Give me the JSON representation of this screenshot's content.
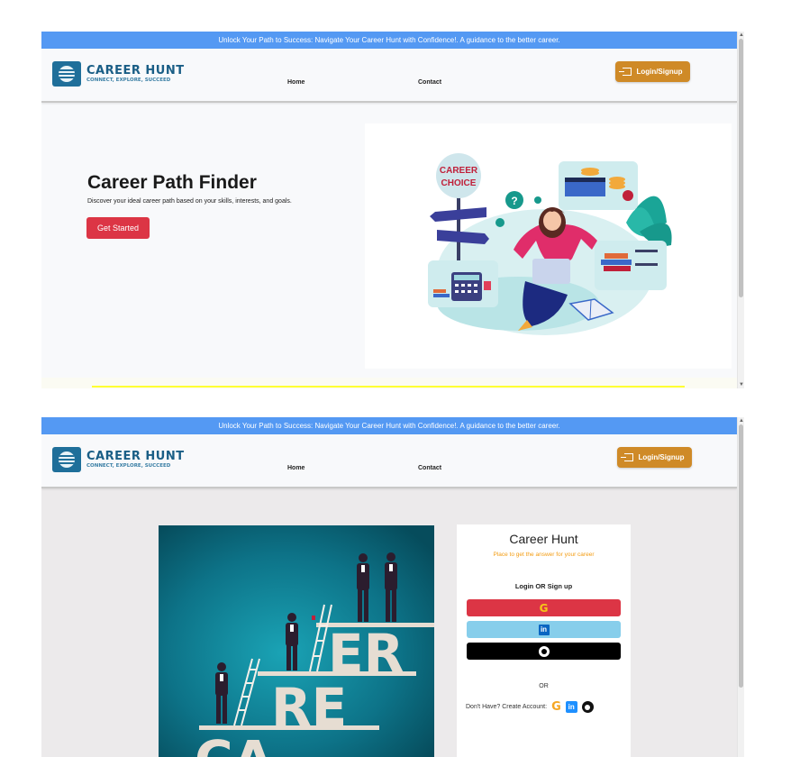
{
  "banner": {
    "text": "Unlock Your Path to Success: Navigate Your Career Hunt with Confidence!. A guidance to the better career."
  },
  "brand": {
    "name": "CAREER HUNT",
    "tagline": "CONNECT, EXPLORE, SUCCEED"
  },
  "nav": {
    "home": "Home",
    "contact": "Contact",
    "login_signup": "Login/Signup"
  },
  "hero": {
    "title": "Career Path Finder",
    "subtitle": "Discover your ideal career path based on your skills, interests, and goals.",
    "cta": "Get Started",
    "sign_text": "CAREER CHOICE"
  },
  "login": {
    "title": "Career Hunt",
    "subtitle": "Place to get the answer for your career",
    "heading": "Login OR Sign up",
    "or": "OR",
    "create_account": "Don't Have? Create Account:"
  },
  "poster": {
    "letters_top": "ER",
    "letters_mid": "RE",
    "letters_bottom": "CA"
  },
  "colors": {
    "banner": "#5499f3",
    "login_button": "#cf8a27",
    "cta": "#dc3545",
    "google_button": "#dc3545",
    "linkedin_button": "#87ceeb",
    "github_button": "#000000",
    "subtitle_orange": "#f39c12"
  },
  "icons": {
    "login": "login-icon",
    "google": "google-icon",
    "linkedin": "linkedin-icon",
    "github": "github-icon"
  }
}
